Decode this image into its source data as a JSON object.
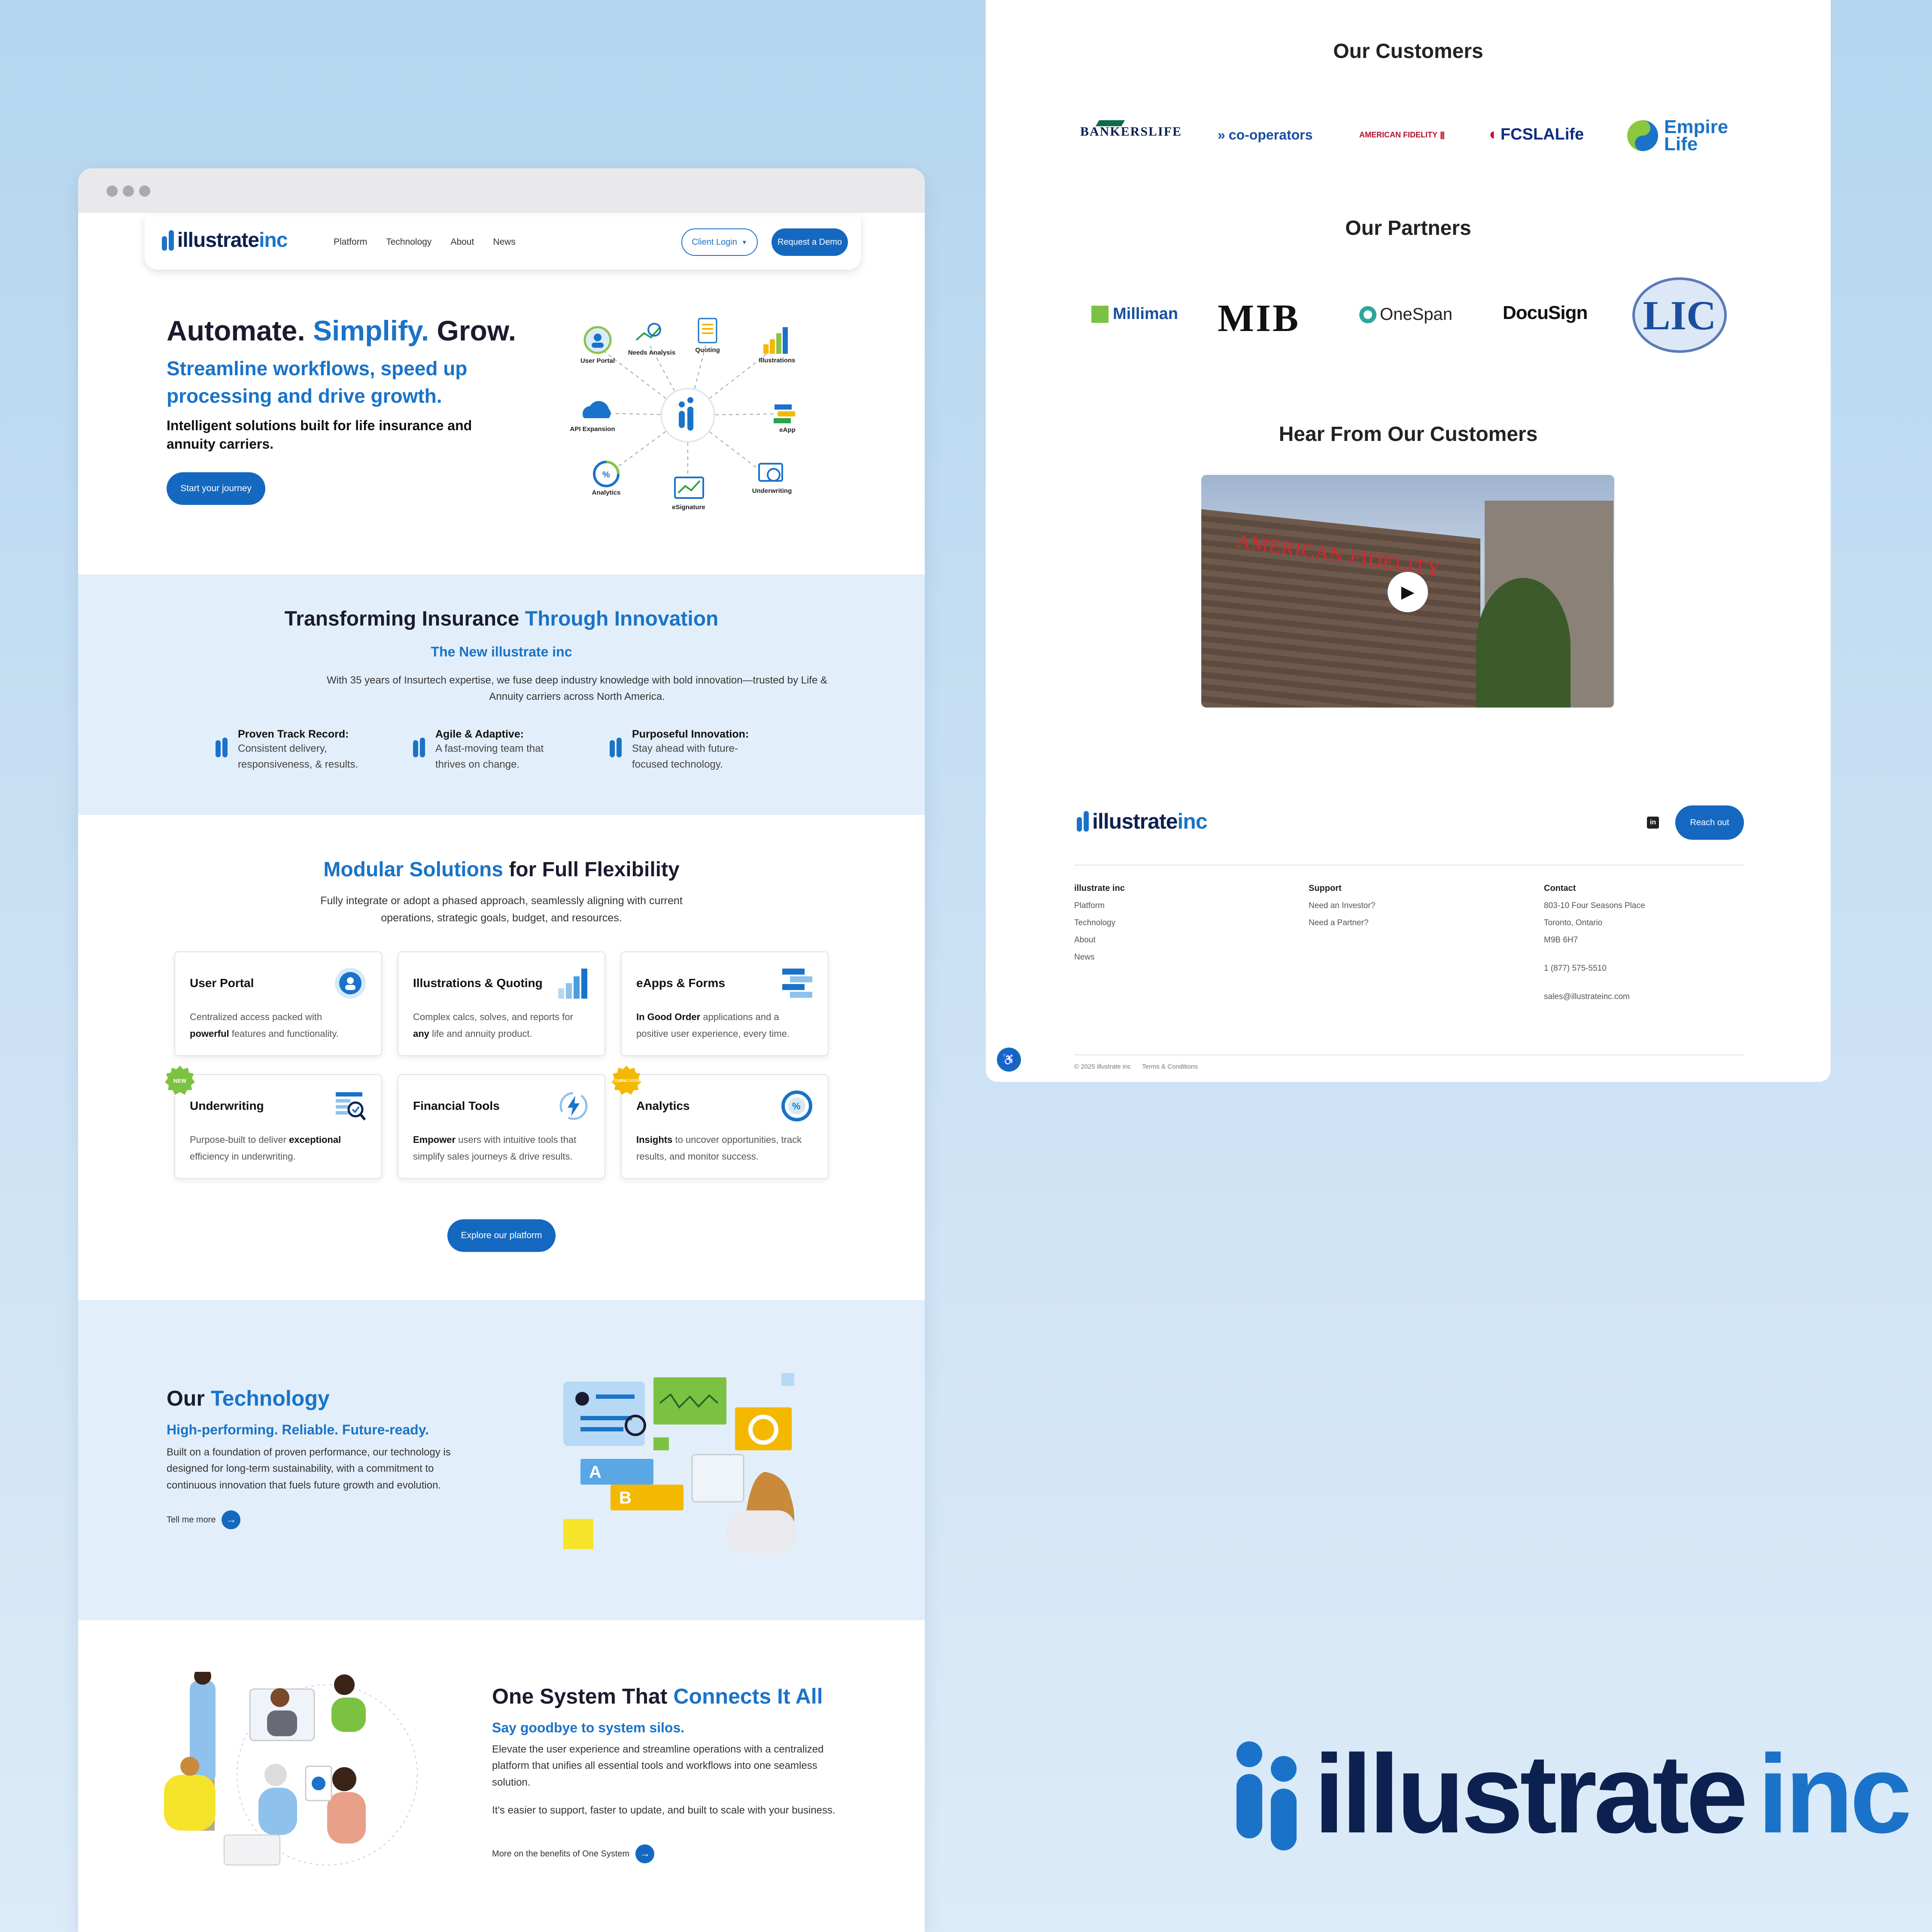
{
  "colors": {
    "accent": "#1a73c8",
    "dark": "#1b1b2f",
    "background": "#b5d6ef"
  },
  "browser": {
    "dots": 3
  },
  "nav": {
    "brand": {
      "main": "illustrate",
      "suffix": "inc"
    },
    "links": [
      "Platform",
      "Technology",
      "About",
      "News"
    ],
    "client_login": "Client Login",
    "demo": "Request a Demo"
  },
  "hero": {
    "title_a": "Automate.",
    "title_b": "Simplify.",
    "title_c": "Grow.",
    "subtitle": "Streamline workflows, speed up processing and drive growth.",
    "body": "Intelligent solutions built for life insurance and annuity carriers.",
    "cta": "Start your journey",
    "diagram": [
      "User Portal",
      "Needs Analysis",
      "Quoting",
      "Illustrations",
      "API Expansion",
      "eApp",
      "Analytics",
      "eSignature",
      "Underwriting"
    ]
  },
  "innovation": {
    "title_a": "Transforming Insurance",
    "title_b": "Through Innovation",
    "subtitle": "The New illustrate inc",
    "body": "With 35 years of Insurtech expertise, we fuse deep industry knowledge with bold innovation—trusted by Life & Annuity carriers across North America.",
    "features": [
      {
        "title": "Proven Track Record:",
        "text": "Consistent delivery, responsiveness, & results."
      },
      {
        "title": "Agile & Adaptive:",
        "text": "A fast-moving team that thrives on change."
      },
      {
        "title": "Purposeful Innovation:",
        "text": "Stay ahead with future-focused technology."
      }
    ]
  },
  "modular": {
    "title_a": "Modular Solutions",
    "title_b": "for Full Flexibility",
    "body": "Fully integrate or adopt a phased approach, seamlessly aligning with current operations, strategic goals, budget, and resources.",
    "cards": [
      {
        "title": "User Portal",
        "pre": "Centralized access packed with ",
        "bold": "powerful",
        "post": " features and functionality.",
        "icon": "user-icon"
      },
      {
        "title": "Illustrations & Quoting",
        "pre": "Complex calcs, solves, and reports for ",
        "bold": "any",
        "post": " life and annuity product.",
        "icon": "bar-chart-icon"
      },
      {
        "title": "eApps & Forms",
        "pre": "",
        "bold": "In Good Order",
        "post": " applications and a positive user experience, every time.",
        "icon": "form-icon"
      },
      {
        "title": "Underwriting",
        "pre": "Purpose-built to deliver ",
        "bold": "exceptional",
        "post": " efficiency in underwriting.",
        "icon": "magnify-icon",
        "badge": "NEW"
      },
      {
        "title": "Financial Tools",
        "pre": "",
        "bold": "Empower",
        "post": " users with intuitive tools that simplify sales journeys & drive results.",
        "icon": "lightning-icon"
      },
      {
        "title": "Analytics",
        "pre": "",
        "bold": "Insights",
        "post": " to uncover opportunities, track results, and monitor success.",
        "icon": "percent-icon",
        "badge": "COMING SOON"
      }
    ],
    "cta": "Explore our platform"
  },
  "technology": {
    "title_a": "Our",
    "title_b": "Technology",
    "subtitle": "High-performing. Reliable. Future-ready.",
    "body": "Built on a foundation of proven performance, our technology is designed for long-term sustainability, with a commitment to continuous innovation that fuels future growth and evolution.",
    "link": "Tell me more"
  },
  "onesystem": {
    "title_a": "One System That",
    "title_b": "Connects It All",
    "subtitle": "Say goodbye to system silos.",
    "body1": "Elevate the user experience and streamline operations with a centralized platform that unifies all essential tools and workflows into one seamless solution.",
    "body2": "It's easier to support, faster to update, and built to scale with your business.",
    "link": "More on the benefits of One System"
  },
  "customers": {
    "title": "Our Customers",
    "logos": [
      "BANKERSLIFE",
      "co-operators",
      "AMERICAN FIDELITY",
      "FCSLALife",
      "Empire",
      "Life"
    ]
  },
  "partners": {
    "title": "Our Partners",
    "logos": [
      "Milliman",
      "MIB",
      "OneSpan",
      "DocuSign",
      "LIC"
    ]
  },
  "testimonial": {
    "title": "Hear From Our Customers",
    "sign": "AMERICAN FIDELITY"
  },
  "footer": {
    "cta": "Reach out",
    "col1": {
      "title": "illustrate inc",
      "items": [
        "Platform",
        "Technology",
        "About",
        "News"
      ]
    },
    "col2": {
      "title": "Support",
      "items": [
        "Need an Investor?",
        "Need a Partner?"
      ]
    },
    "col3": {
      "title": "Contact",
      "address": [
        "803-10 Four Seasons Place",
        "Toronto, Ontario",
        "M9B 6H7"
      ],
      "phone": "1 (877) 575-5510",
      "email": "sales@illustrateinc.com"
    },
    "copyright": "© 2025 illustrate inc",
    "terms": "Terms & Conditions"
  }
}
